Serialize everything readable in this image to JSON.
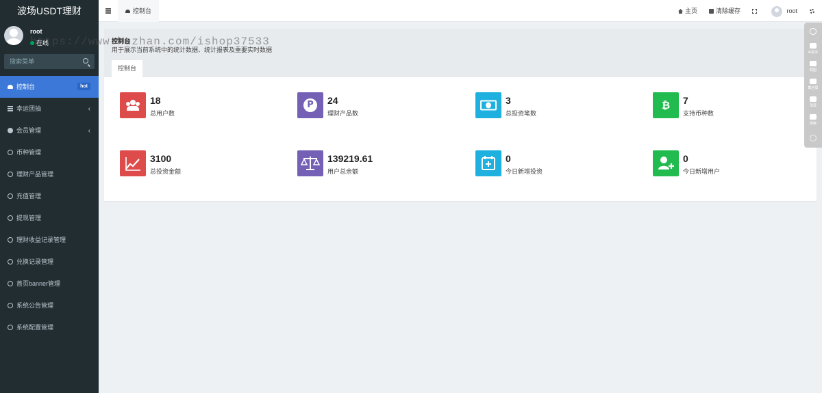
{
  "brand": "波场USDT理财",
  "user": {
    "name": "root",
    "status": "在线"
  },
  "search": {
    "placeholder": "搜索菜单"
  },
  "menu": [
    {
      "label": "控制台",
      "icon": "dashboard-icon",
      "badge": "hot",
      "active": true
    },
    {
      "label": "幸运团抽",
      "icon": "list-icon",
      "chevron": "‹"
    },
    {
      "label": "会员管理",
      "icon": "user-circle-icon",
      "chevron": "‹"
    },
    {
      "label": "币种管理",
      "icon": "circle-icon"
    },
    {
      "label": "理财产品管理",
      "icon": "circle-icon"
    },
    {
      "label": "充值管理",
      "icon": "circle-icon"
    },
    {
      "label": "提现管理",
      "icon": "circle-icon"
    },
    {
      "label": "理财收益记录管理",
      "icon": "circle-icon"
    },
    {
      "label": "兑换记录管理",
      "icon": "circle-icon"
    },
    {
      "label": "首页banner管理",
      "icon": "circle-icon"
    },
    {
      "label": "系统公告管理",
      "icon": "circle-icon"
    },
    {
      "label": "系统配置管理",
      "icon": "circle-icon"
    }
  ],
  "navbar": {
    "tab": "控制台",
    "home": "主页",
    "clear_cache": "清除缓存",
    "username": "root"
  },
  "header": {
    "title": "控制台",
    "description": "用于展示当前系统中的统计数据、统计报表及重要实时数据",
    "tab": "控制台"
  },
  "stats": [
    {
      "value": "18",
      "label": "总用户数",
      "color": "#dd4b4b",
      "icon": "users-icon"
    },
    {
      "value": "24",
      "label": "理财产品数",
      "color": "#7461b6",
      "icon": "product-p-icon"
    },
    {
      "value": "3",
      "label": "总投资笔数",
      "color": "#1eb0de",
      "icon": "money-bill-icon"
    },
    {
      "value": "7",
      "label": "支持币种数",
      "color": "#22bb4f",
      "icon": "bitcoin-icon"
    },
    {
      "value": "3100",
      "label": "总投资金额",
      "color": "#dd4b4b",
      "icon": "line-chart-icon"
    },
    {
      "value": "139219.61",
      "label": "用户总余额",
      "color": "#7461b6",
      "icon": "balance-scale-icon"
    },
    {
      "value": "0",
      "label": "今日新增投资",
      "color": "#1eb0de",
      "icon": "calendar-plus-icon"
    },
    {
      "value": "0",
      "label": "今日新增用户",
      "color": "#22bb4f",
      "icon": "user-plus-icon"
    }
  ],
  "watermark": "https://www.huzhan.com/ishop37533",
  "floatbar": [
    "AI助手",
    "截图",
    "截全屏",
    "录屏",
    "搜索"
  ]
}
